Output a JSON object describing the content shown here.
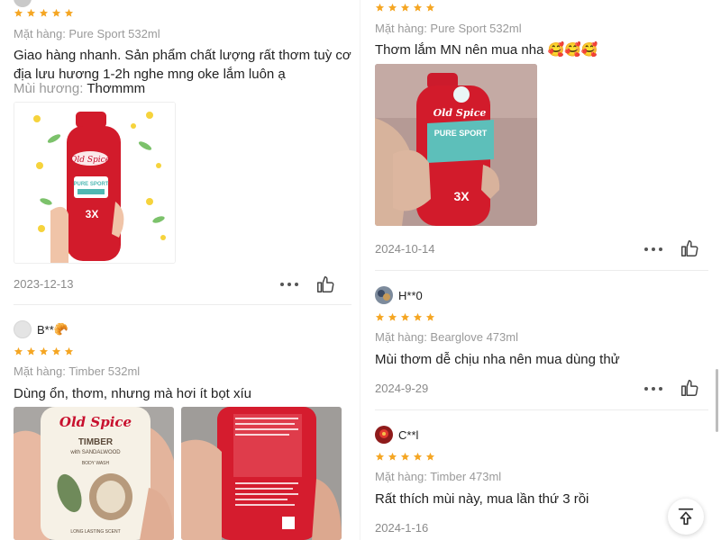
{
  "left": {
    "r1": {
      "item": "Mặt hàng: Pure Sport 532ml",
      "text_line1": "Giao hàng nhanh. Sản phẩm chất lượng rất thơm tuỳ cơ",
      "text_line2": "địa lưu hương 1-2h nghe mng oke lắm luôn ạ",
      "scent_label": "Mùi hương:",
      "scent_value": "Thơmmm",
      "date": "2023-12-13"
    },
    "r2": {
      "user": "B**",
      "user_emoji": "🥐",
      "item": "Mặt hàng: Timber 532ml",
      "text": "Dùng ổn, thơm, nhưng mà hơi ít bọt xíu"
    }
  },
  "right": {
    "r1": {
      "item": "Mặt hàng: Pure Sport 532ml",
      "text": "Thơm lắm MN nên mua nha",
      "emojis": "🥰🥰🥰",
      "date": "2024-10-14"
    },
    "r2": {
      "user": "H**0",
      "item": "Mặt hàng: Bearglove 473ml",
      "text": "Mùi thơm dễ chịu nha nên mua dùng thử",
      "date": "2024-9-29"
    },
    "r3": {
      "user": "C**l",
      "item": "Mặt hàng: Timber 473ml",
      "text": "Rất thích mùi này, mua lần thứ 3 rồi",
      "date": "2024-1-16"
    }
  },
  "product": {
    "brand": "Old Spice",
    "pure_sport_label": "PURE SPORT",
    "times_label": "3X",
    "timber_label": "TIMBER",
    "timber_sub": "with SANDALWOOD",
    "body_wash": "BODY WASH",
    "long_lasting": "LONG LASTING SCENT"
  },
  "colors": {
    "star": "#f5a623",
    "text": "#222222",
    "meta": "#9a9a9a",
    "bottle_red": "#c8102e",
    "teal": "#4fb8b3"
  },
  "icons": {
    "star": "star-icon",
    "more": "more-icon",
    "like": "thumbs-up-icon",
    "scroll_top": "scroll-to-top-icon"
  }
}
